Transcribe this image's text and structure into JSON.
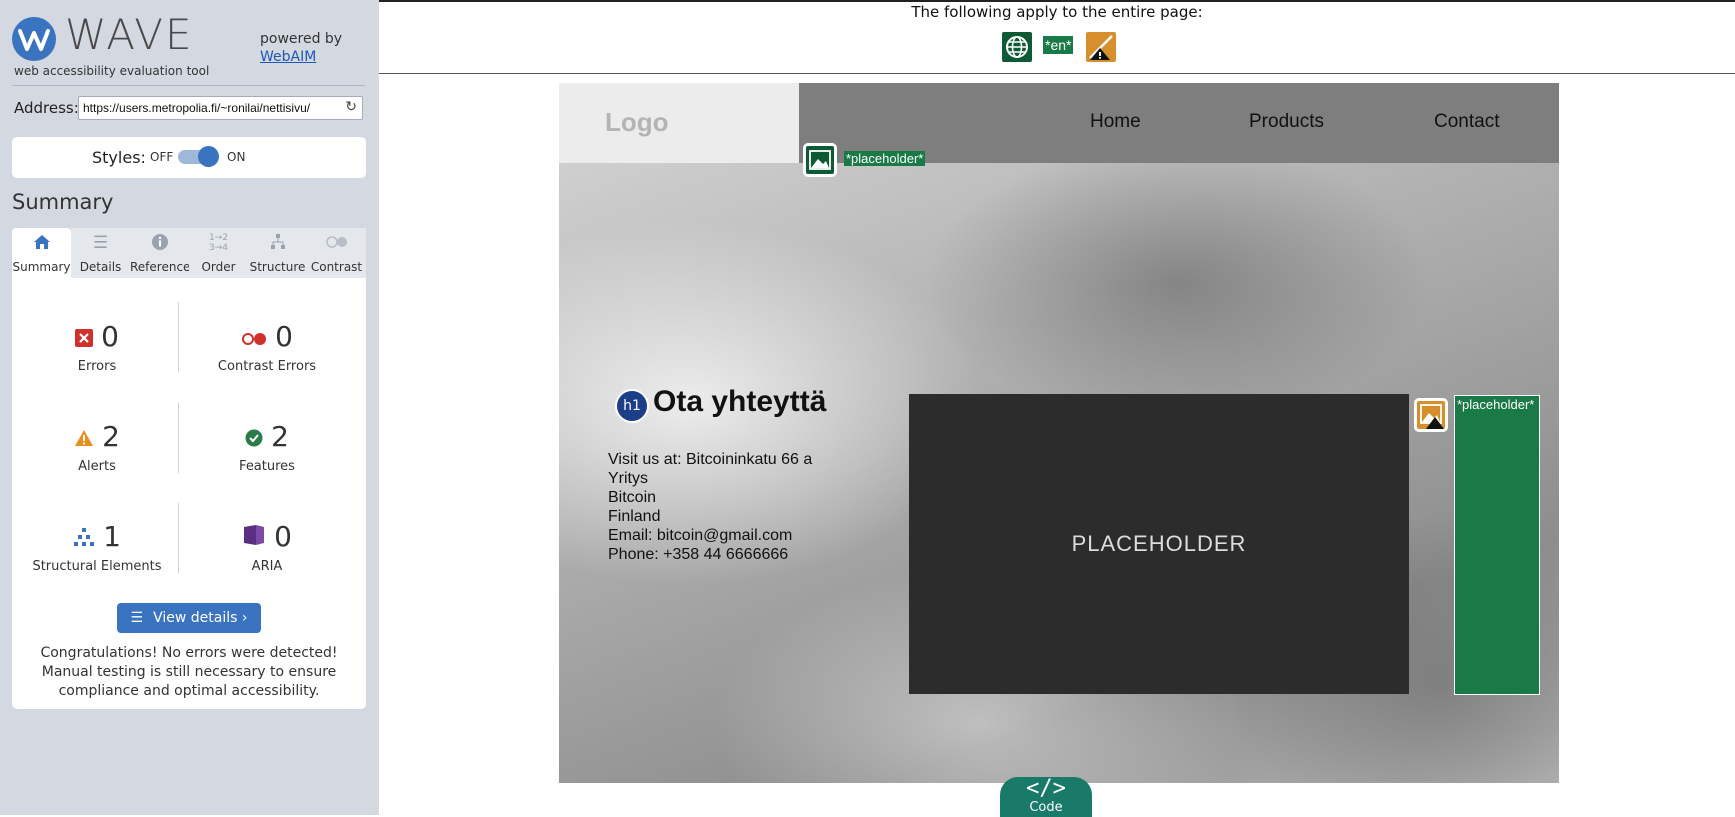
{
  "sidebar": {
    "app_name": "WAVE",
    "tagline": "web accessibility evaluation tool",
    "powered_by": "powered by",
    "powered_link": "WebAIM",
    "address_label": "Address:",
    "address_value": "https://users.metropolia.fi/~ronilai/nettisivu/",
    "styles_label": "Styles:",
    "styles_off": "OFF",
    "styles_on": "ON",
    "styles_state": "on",
    "summary_title": "Summary",
    "tabs": [
      {
        "label": "Summary",
        "icon": "home-icon",
        "active": true
      },
      {
        "label": "Details",
        "icon": "list-icon"
      },
      {
        "label": "Reference",
        "icon": "info-icon"
      },
      {
        "label": "Order",
        "icon": "order-icon"
      },
      {
        "label": "Structure",
        "icon": "structure-icon"
      },
      {
        "label": "Contrast",
        "icon": "contrast-icon"
      }
    ],
    "stats": {
      "errors": {
        "count": "0",
        "label": "Errors",
        "color": "#d0312d"
      },
      "contrast_errors": {
        "count": "0",
        "label": "Contrast Errors",
        "color": "#d0312d"
      },
      "alerts": {
        "count": "2",
        "label": "Alerts",
        "color": "#e8901d"
      },
      "features": {
        "count": "2",
        "label": "Features",
        "color": "#2a7a4a"
      },
      "structural": {
        "count": "1",
        "label": "Structural Elements",
        "color": "#3a74c0"
      },
      "aria": {
        "count": "0",
        "label": "ARIA",
        "color": "#5a2e82"
      }
    },
    "view_details": "View details ›",
    "congrats": "Congratulations! No errors were detected! Manual testing is still necessary to ensure compliance and optimal accessibility."
  },
  "main": {
    "apply_text": "The following apply to the entire page:",
    "page_icons": [
      "language-globe-icon",
      "lang-en-label",
      "alert-icon"
    ],
    "lang_label": "*en*"
  },
  "site": {
    "logo": "Logo",
    "nav": [
      "Home",
      "Products",
      "Contact"
    ],
    "alt_placeholder": "*placeholder*",
    "h1_badge": "h1",
    "heading": "Ota yhteyttä",
    "address_lines": [
      "Visit us at: Bitcoininkatu 66 a",
      "Yritys",
      "Bitcoin",
      "Finland",
      "Email: bitcoin@gmail.com",
      "Phone: +358 44 6666666"
    ],
    "placeholder_text": "PLACEHOLDER"
  },
  "code_tab": {
    "icon": "</>",
    "label": "Code"
  },
  "colors": {
    "accent": "#3a74c0",
    "feature_green": "#1a7a47",
    "sidebar_bg": "#d4d9e1"
  }
}
